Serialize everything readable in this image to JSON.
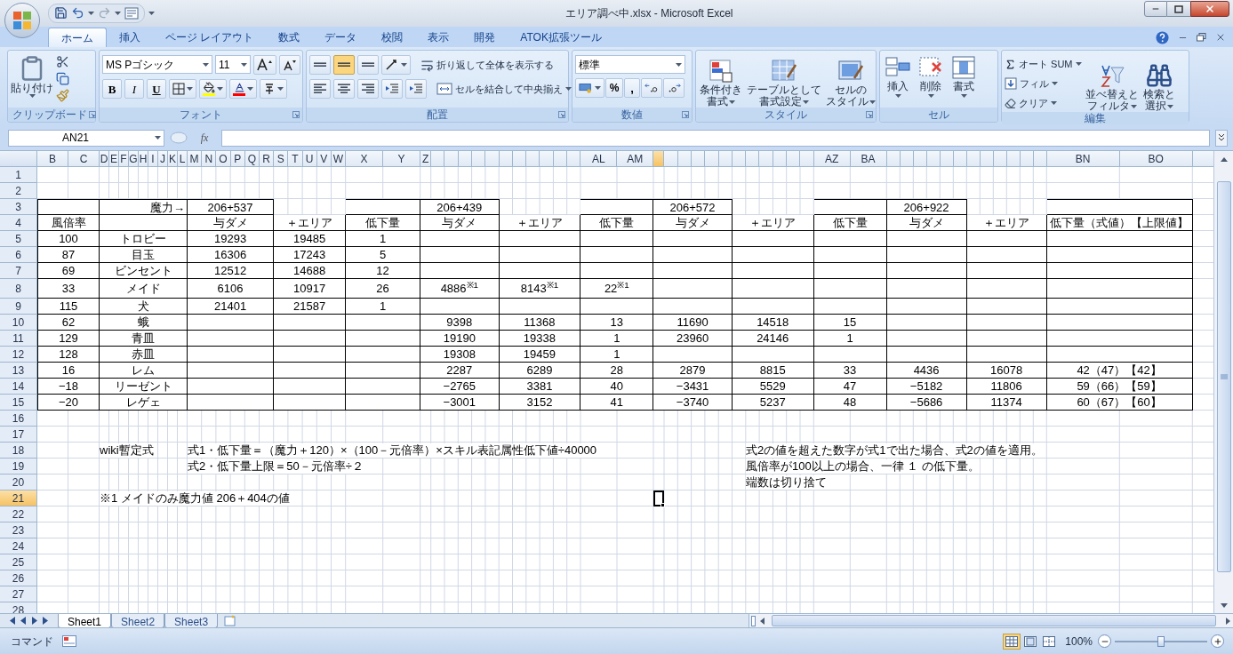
{
  "window": {
    "title": "エリア調べ中.xlsx - Microsoft Excel"
  },
  "ribbon_tabs": [
    {
      "label": "ホーム",
      "selected": true
    },
    {
      "label": "挿入",
      "selected": false
    },
    {
      "label": "ページ レイアウト",
      "selected": false
    },
    {
      "label": "数式",
      "selected": false
    },
    {
      "label": "データ",
      "selected": false
    },
    {
      "label": "校閲",
      "selected": false
    },
    {
      "label": "表示",
      "selected": false
    },
    {
      "label": "開発",
      "selected": false
    },
    {
      "label": "ATOK拡張ツール",
      "selected": false
    }
  ],
  "clipboard": {
    "label": "クリップボード",
    "paste": "貼り付け"
  },
  "font": {
    "label": "フォント",
    "name": "MS Pゴシック",
    "size": "11",
    "format_buttons": [
      "B",
      "I",
      "U"
    ]
  },
  "alignment": {
    "label": "配置",
    "vertical": [
      {
        "selected": false
      },
      {
        "selected": true
      },
      {
        "selected": false
      }
    ],
    "wrap": "折り返して全体を表示する",
    "merge": "セルを結合して中央揃え"
  },
  "number": {
    "label": "数値",
    "format": "標準",
    "percent": "%",
    "comma": ","
  },
  "styles": {
    "label": "スタイル",
    "buttons": [
      [
        "条件付き",
        "書式"
      ],
      [
        "テーブルとして",
        "書式設定"
      ],
      [
        "セルの",
        "スタイル"
      ]
    ]
  },
  "cells": {
    "label": "セル",
    "buttons": [
      "挿入",
      "削除",
      "書式"
    ]
  },
  "editing": {
    "label": "編集",
    "autosum": "オート SUM",
    "fill": "フィル",
    "clear": "クリア",
    "sort": [
      "並べ替えと",
      "フィルタ"
    ],
    "find": [
      "検索と",
      "選択"
    ]
  },
  "name_box": "AN21",
  "fx": "fx",
  "column_headers": [
    {
      "label": "B",
      "selected": false
    },
    {
      "label": "C",
      "selected": false
    },
    {
      "label": "D",
      "selected": false
    },
    {
      "label": "E",
      "selected": false
    },
    {
      "label": "F",
      "selected": false
    },
    {
      "label": "G",
      "selected": false
    },
    {
      "label": "H",
      "selected": false
    },
    {
      "label": "I",
      "selected": false
    },
    {
      "label": "J",
      "selected": false
    },
    {
      "label": "K",
      "selected": false
    },
    {
      "label": "L",
      "selected": false
    },
    {
      "label": "M",
      "selected": false
    },
    {
      "label": "N",
      "selected": false
    },
    {
      "label": "O",
      "selected": false
    },
    {
      "label": "P",
      "selected": false
    },
    {
      "label": "Q",
      "selected": false
    },
    {
      "label": "R",
      "selected": false
    },
    {
      "label": "S",
      "selected": false
    },
    {
      "label": "T",
      "selected": false
    },
    {
      "label": "U",
      "selected": false
    },
    {
      "label": "V",
      "selected": false
    },
    {
      "label": "W",
      "selected": false
    },
    {
      "label": "X",
      "selected": false
    },
    {
      "label": "Y",
      "selected": false
    },
    {
      "label": "Z",
      "selected": false
    },
    {
      "selected": false
    },
    {
      "selected": false
    },
    {
      "selected": false
    },
    {
      "selected": false
    },
    {
      "selected": false
    },
    {
      "selected": false
    },
    {
      "selected": false
    },
    {
      "selected": false
    },
    {
      "selected": false
    },
    {
      "selected": false
    },
    {
      "selected": false
    },
    {
      "label": "AL",
      "selected": false
    },
    {
      "label": "AM",
      "selected": false
    },
    {
      "selected": true
    },
    {
      "selected": false
    },
    {
      "selected": false
    },
    {
      "selected": false
    },
    {
      "selected": false
    },
    {
      "selected": false
    },
    {
      "selected": false
    },
    {
      "selected": false
    },
    {
      "selected": false
    },
    {
      "selected": false
    },
    {
      "selected": false
    },
    {
      "selected": false
    },
    {
      "label": "AZ",
      "selected": false
    },
    {
      "label": "BA",
      "selected": false
    },
    {
      "selected": false
    },
    {
      "selected": false
    },
    {
      "selected": false
    },
    {
      "selected": false
    },
    {
      "selected": false
    },
    {
      "selected": false
    },
    {
      "selected": false
    },
    {
      "selected": false
    },
    {
      "selected": false
    },
    {
      "selected": false
    },
    {
      "selected": false
    },
    {
      "selected": false
    },
    {
      "label": "BN",
      "selected": false
    },
    {
      "label": "BO",
      "selected": false
    },
    {
      "selected": false
    }
  ],
  "row_headers": [
    {
      "label": "1",
      "selected": false
    },
    {
      "label": "2",
      "selected": false
    },
    {
      "label": "3",
      "selected": false
    },
    {
      "label": "4",
      "selected": false
    },
    {
      "label": "5",
      "selected": false
    },
    {
      "label": "6",
      "selected": false
    },
    {
      "label": "7",
      "selected": false
    },
    {
      "label": "8",
      "selected": false
    },
    {
      "label": "9",
      "selected": false
    },
    {
      "label": "10",
      "selected": false
    },
    {
      "label": "11",
      "selected": false
    },
    {
      "label": "12",
      "selected": false
    },
    {
      "label": "13",
      "selected": false
    },
    {
      "label": "14",
      "selected": false
    },
    {
      "label": "15",
      "selected": false
    },
    {
      "label": "16",
      "selected": false
    },
    {
      "label": "17",
      "selected": false
    },
    {
      "label": "18",
      "selected": false
    },
    {
      "label": "19",
      "selected": false
    },
    {
      "label": "20",
      "selected": false
    },
    {
      "label": "21",
      "selected": true
    },
    {
      "label": "22",
      "selected": false
    },
    {
      "label": "23",
      "selected": false
    },
    {
      "label": "24",
      "selected": false
    },
    {
      "label": "25",
      "selected": false
    },
    {
      "label": "26",
      "selected": false
    },
    {
      "label": "27",
      "selected": false
    },
    {
      "label": "28",
      "selected": false
    }
  ],
  "table": {
    "groups": [
      "魔力→",
      "206+537",
      "206+439",
      "206+572",
      "206+922"
    ],
    "columns": [
      "風倍率",
      null,
      "与ダメ",
      "＋エリア",
      "低下量",
      "与ダメ",
      "＋エリア",
      "低下量",
      "与ダメ",
      "＋エリア",
      "低下量",
      "与ダメ",
      "＋エリア",
      "低下量（式値）【上限値】"
    ],
    "rows": [
      [
        "100",
        "トロビー",
        "19293",
        "19485",
        "1",
        null,
        null,
        null,
        null,
        null,
        null,
        null,
        null,
        null
      ],
      [
        "87",
        "目玉",
        "16306",
        "17243",
        "5",
        null,
        null,
        null,
        null,
        null,
        null,
        null,
        null,
        null
      ],
      [
        "69",
        "ビンセント",
        "12512",
        "14688",
        "12",
        null,
        null,
        null,
        null,
        null,
        null,
        null,
        null,
        null
      ],
      [
        "33",
        "メイド",
        "6106",
        "10917",
        "26",
        "4886$^{※1}$",
        "8143$^{※1}$",
        "22$^{※1}$",
        null,
        null,
        null,
        null,
        null,
        null
      ],
      [
        "115",
        "犬",
        "21401",
        "21587",
        "1",
        null,
        null,
        null,
        null,
        null,
        null,
        null,
        null,
        null
      ],
      [
        "62",
        "蛾",
        null,
        null,
        null,
        "9398",
        "11368",
        "13",
        "11690",
        "14518",
        "15",
        null,
        null,
        null
      ],
      [
        "129",
        "青皿",
        null,
        null,
        null,
        "19190",
        "19338",
        "1",
        "23960",
        "24146",
        "1",
        null,
        null,
        null
      ],
      [
        "128",
        "赤皿",
        null,
        null,
        null,
        "19308",
        "19459",
        "1",
        null,
        null,
        null,
        null,
        null,
        null
      ],
      [
        "16",
        "レム",
        null,
        null,
        null,
        "2287",
        "6289",
        "28",
        "2879",
        "8815",
        "33",
        "4436",
        "16078",
        "42（47）【42】"
      ],
      [
        "−18",
        "リーゼント",
        null,
        null,
        null,
        "−2765",
        "3381",
        "40",
        "−3431",
        "5529",
        "47",
        "−5182",
        "11806",
        "59（66）【59】"
      ],
      [
        "−20",
        "レゲェ",
        null,
        null,
        null,
        "−3001",
        "3152",
        "41",
        "−3740",
        "5237",
        "48",
        "−5686",
        "11374",
        "60（67）【60】"
      ]
    ]
  },
  "notes": {
    "label": "wiki暫定式",
    "formula_1": "式1・低下量＝（魔力＋120）×（100－元倍率）×スキル表記属性低下値÷40000",
    "formula_2": "式2・低下量上限＝50－元倍率÷２",
    "remarks": [
      "式2の値を超えた数字が式1で出た場合、式2の値を適用。",
      "風倍率が100以上の場合、一律 １ の低下量。",
      "端数は切り捨て"
    ],
    "footnote": "※1 メイドのみ魔力値 206＋404の値"
  },
  "sheet_tabs": [
    {
      "label": "Sheet1",
      "selected": true
    },
    {
      "label": "Sheet2",
      "selected": false
    },
    {
      "label": "Sheet3",
      "selected": false
    }
  ],
  "status_bar": {
    "mode": "コマンド",
    "views": [
      {
        "selected": true
      },
      {
        "selected": false
      },
      {
        "selected": false
      }
    ],
    "zoom": "100%",
    "zoom_slider": {
      "level": 0.5
    }
  }
}
